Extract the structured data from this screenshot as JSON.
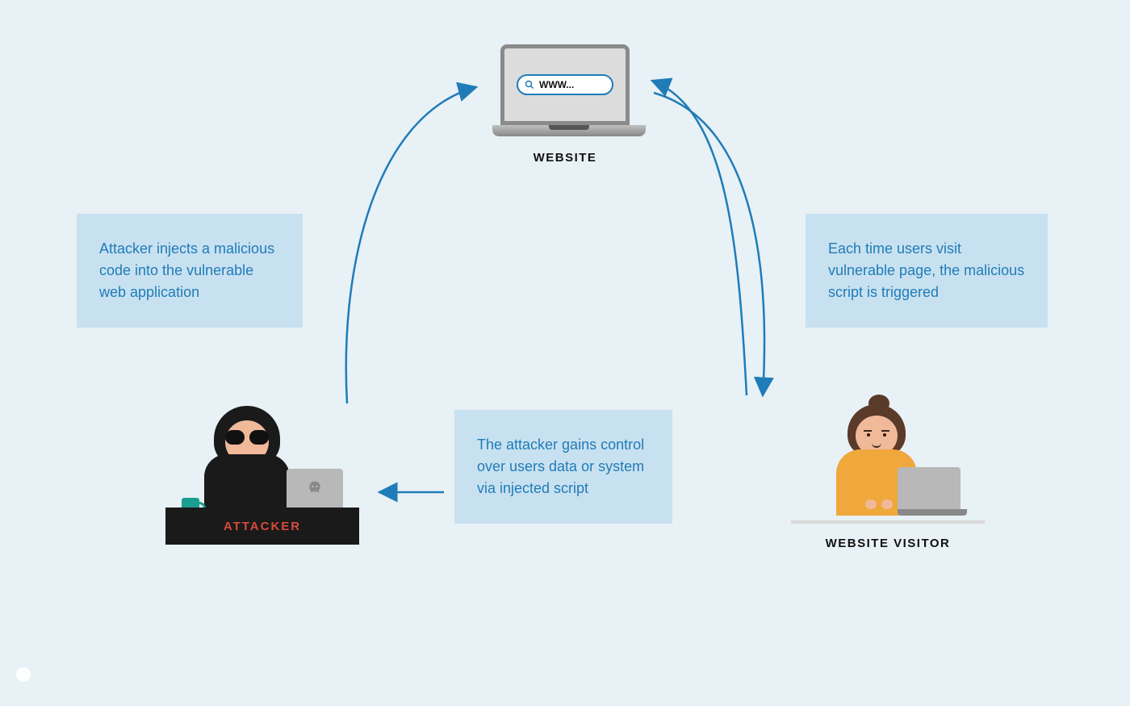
{
  "nodes": {
    "website": {
      "label": "WEBSITE",
      "url_placeholder": "WWW..."
    },
    "attacker": {
      "label": "ATTACKER"
    },
    "visitor": {
      "label": "WEBSITE VISITOR"
    }
  },
  "boxes": {
    "inject": "Attacker injects a malicious code into the vulnerable web application",
    "trigger": "Each time users visit vulnerable page, the malicious script is triggered",
    "gain": "The attacker gains control over users data or system via injected script"
  },
  "colors": {
    "bg": "#e8f1f5",
    "box": "#c8e1f0",
    "accent": "#1f7cb8",
    "attacker_red": "#d84a3a"
  }
}
